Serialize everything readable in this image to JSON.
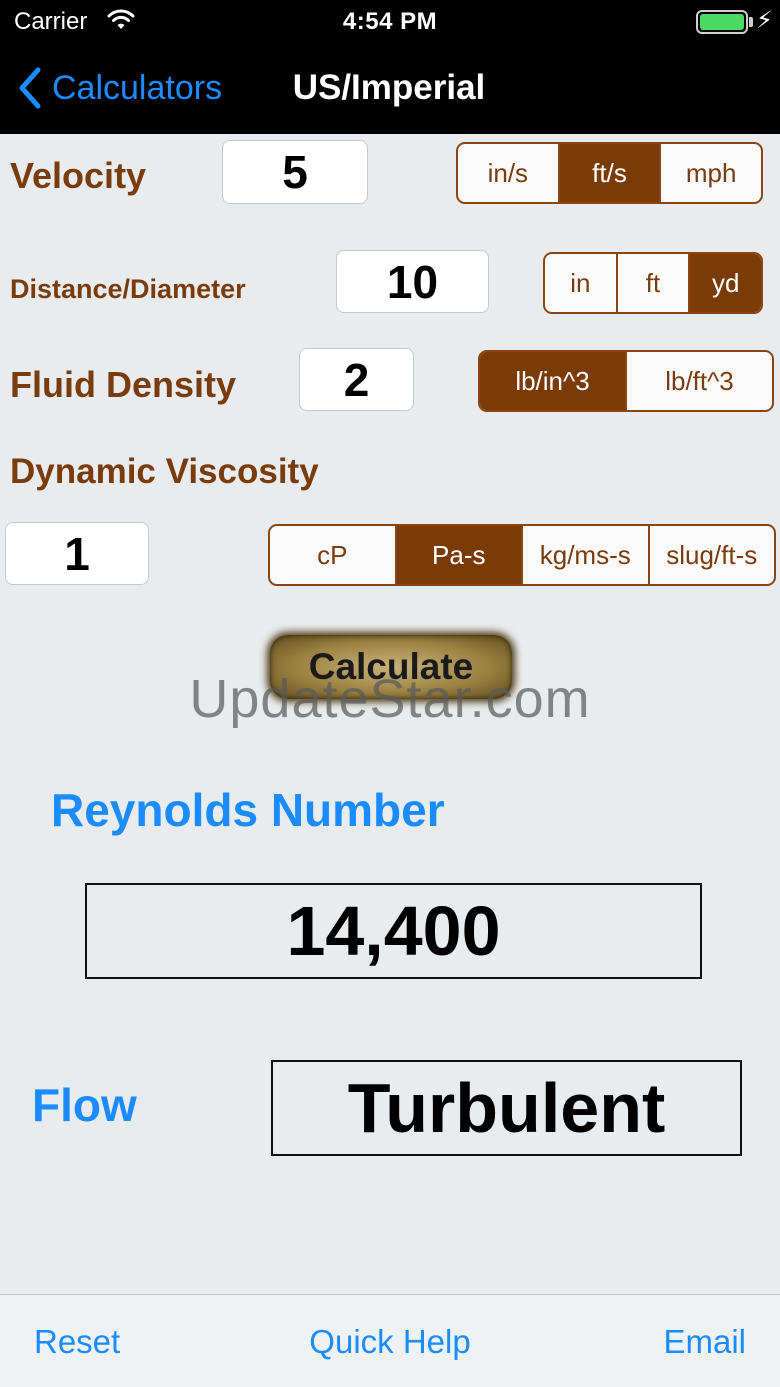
{
  "status_bar": {
    "carrier": "Carrier",
    "time": "4:54 PM",
    "battery_level": 1.0
  },
  "nav": {
    "back_label": "Calculators",
    "title": "US/Imperial"
  },
  "velocity": {
    "label": "Velocity",
    "value": "5",
    "units": [
      "in/s",
      "ft/s",
      "mph"
    ],
    "selected_unit": "ft/s"
  },
  "distance": {
    "label": "Distance/Diameter",
    "value": "10",
    "units": [
      "in",
      "ft",
      "yd"
    ],
    "selected_unit": "yd"
  },
  "density": {
    "label": "Fluid Density",
    "value": "2",
    "units": [
      "lb/in^3",
      "lb/ft^3"
    ],
    "selected_unit": "lb/in^3"
  },
  "viscosity": {
    "label": "Dynamic Viscosity",
    "value": "1",
    "units": [
      "cP",
      "Pa-s",
      "kg/ms-s",
      "slug/ft-s"
    ],
    "selected_unit": "Pa-s"
  },
  "calculate_label": "Calculate",
  "watermark": "UpdateStar.com",
  "result": {
    "reynolds_label": "Reynolds Number",
    "reynolds_value": "14,400",
    "flow_label": "Flow",
    "flow_value": "Turbulent"
  },
  "toolbar": {
    "reset": "Reset",
    "quick_help": "Quick Help",
    "email": "Email"
  },
  "colors": {
    "brown": "#7a3c0d",
    "selected_segment": "#7b3b06",
    "blue": "#1a8cff",
    "background": "#e9ecee"
  }
}
